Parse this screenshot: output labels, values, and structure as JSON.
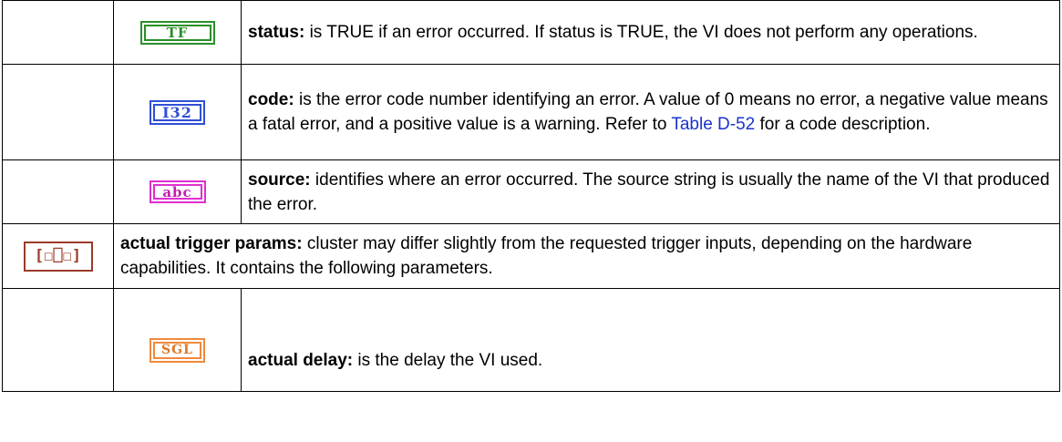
{
  "rows": [
    {
      "icon": {
        "name": "boolean-tf-icon",
        "text": "TF",
        "color": "#2a8f2a"
      },
      "term": "status:",
      "text": " is TRUE if an error occurred. If status is TRUE, the VI does not perform any operations."
    },
    {
      "icon": {
        "name": "i32-numeric-icon",
        "text": "I32",
        "color": "#2f4fd6"
      },
      "term": "code:",
      "text": " is the error code number identifying an error. A value of 0 means no error, a negative value means a fatal error, and a positive value is a warning. Refer to ",
      "link": "Table D-52",
      "text_after": " for a code description."
    },
    {
      "icon": {
        "name": "string-abc-icon",
        "text": "abc",
        "color": "#e02ed0"
      },
      "term": "source:",
      "text": " identifies where an error occurred. The source string is usually the name of the VI that produced the error."
    },
    {
      "icon": {
        "name": "cluster-icon",
        "text": "[☐⎕☐]",
        "color": "#9b3b2a"
      },
      "term": "actual trigger params:",
      "text": " cluster may differ slightly from the requested trigger inputs, depending on the hardware capabilities.  It contains the following parameters."
    },
    {
      "icon": {
        "name": "sgl-numeric-icon",
        "text": "SGL",
        "color": "#f08a3c"
      },
      "term": "actual delay:",
      "text": " is the delay the VI used."
    }
  ]
}
